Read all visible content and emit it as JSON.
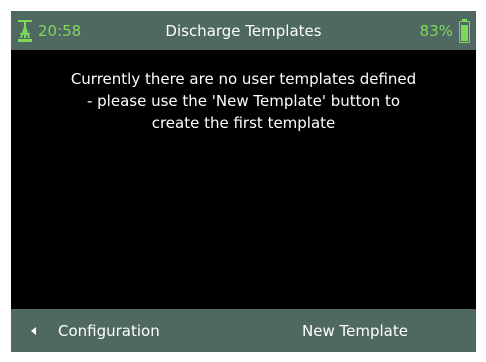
{
  "status": {
    "time": "20:58",
    "title": "Discharge Templates",
    "battery": "83%"
  },
  "message": {
    "lines": [
      "Currently there are no user templates defined",
      "- please use the 'New Template' button to",
      "create the first template"
    ]
  },
  "bottom": {
    "back_label": "Configuration",
    "new_label": "New Template"
  },
  "colors": {
    "bar_bg": "#4f6862",
    "accent_green": "#7ed957",
    "screen_bg": "#000000"
  },
  "icons": {
    "status_left": "antenna-icon",
    "status_right": "battery-icon",
    "back": "triangle-left-icon"
  }
}
